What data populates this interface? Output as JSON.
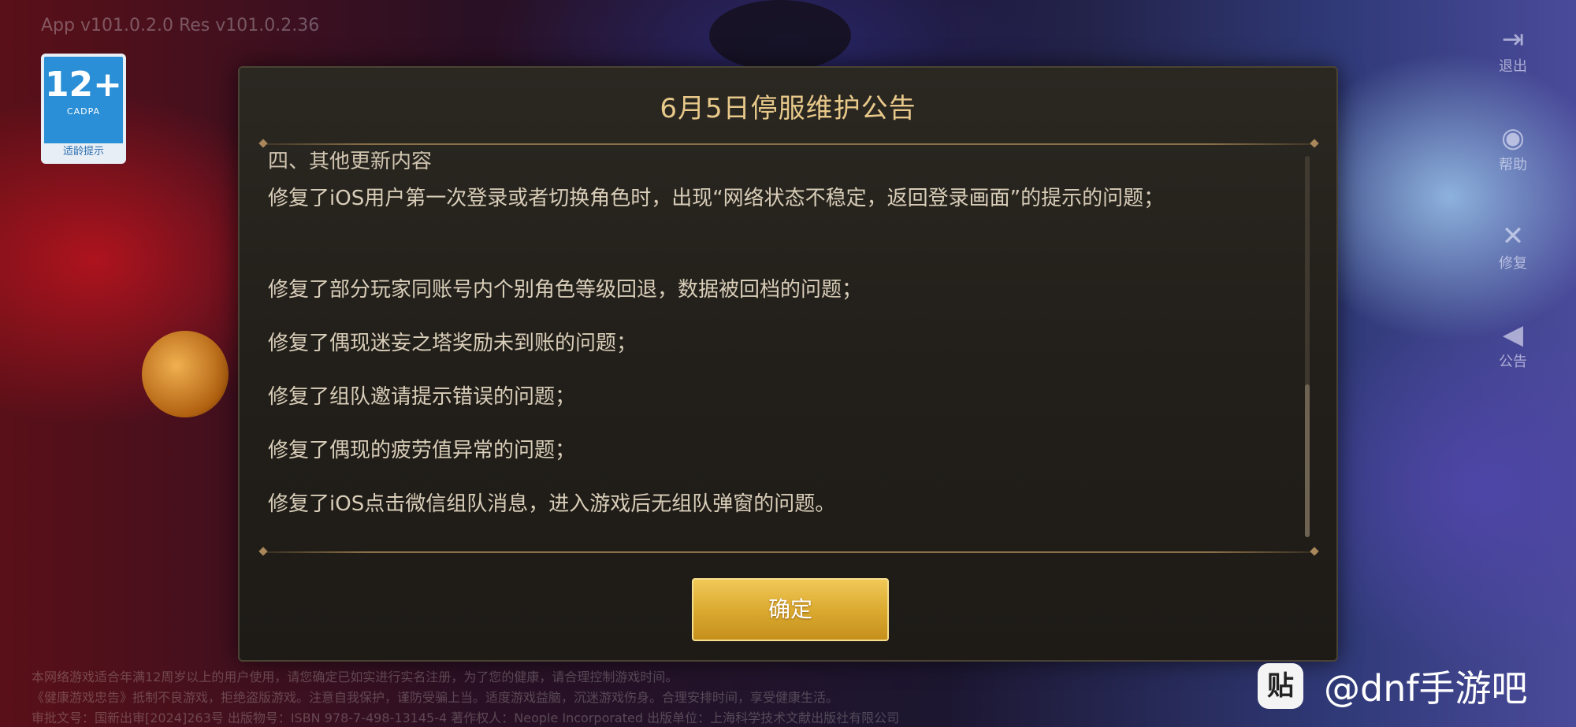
{
  "app": {
    "version_text": "App v101.0.2.0 Res v101.0.2.36"
  },
  "age_badge": {
    "age": "12+",
    "org": "CADPA",
    "hint": "适龄提示"
  },
  "side_menu": [
    {
      "icon": "exit-icon",
      "label": "退出"
    },
    {
      "icon": "help-icon",
      "label": "帮助"
    },
    {
      "icon": "repair-icon",
      "label": "修复"
    },
    {
      "icon": "megaphone-icon",
      "label": "公告"
    }
  ],
  "dialog": {
    "title": "6月5日停服维护公告",
    "section_head": "四、其他更新内容",
    "paragraphs": [
      "修复了iOS用户第一次登录或者切换角色时，出现“网络状态不稳定，返回登录画面”的提示的问题；",
      "修复了部分玩家同账号内个别角色等级回退，数据被回档的问题；",
      "修复了偶现迷妄之塔奖励未到账的问题；",
      "修复了组队邀请提示错误的问题；",
      "修复了偶现的疲劳值异常的问题；",
      "修复了iOS点击微信组队消息，进入游戏后无组队弹窗的问题。"
    ],
    "confirm_label": "确定"
  },
  "footer": {
    "line1": "本网络游戏适合年满12周岁以上的用户使用，请您确定已如实进行实名注册，为了您的健康，请合理控制游戏时间。",
    "line2": "《健康游戏忠告》抵制不良游戏，拒绝盗版游戏。注意自我保护，谨防受骗上当。适度游戏益脑，沉迷游戏伤身。合理安排时间，享受健康生活。",
    "line3": "审批文号：国新出审[2024]263号 出版物号：ISBN 978-7-498-13145-4 著作权人：Neople Incorporated 出版单位：上海科学技术文献出版社有限公司"
  },
  "watermark": {
    "logo": "贴",
    "text": "@dnf手游吧"
  }
}
